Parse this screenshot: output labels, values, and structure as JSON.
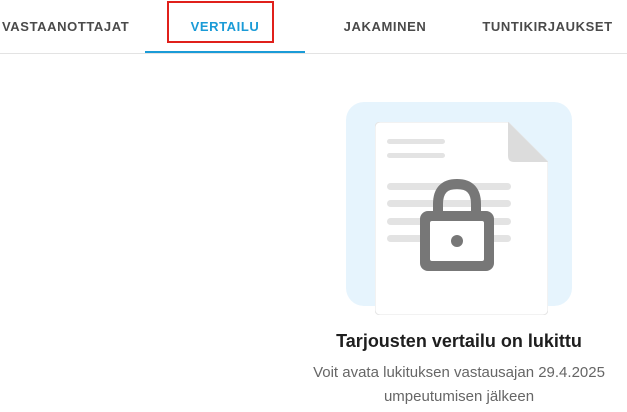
{
  "tabs": [
    {
      "label": "VASTAANOTTAJAT"
    },
    {
      "label": "VERTAILU"
    },
    {
      "label": "JAKAMINEN"
    },
    {
      "label": "TUNTIKIRJAUKSET"
    }
  ],
  "active_tab": "VERTAILU",
  "locked": {
    "title": "Tarjousten vertailu on lukittu",
    "subtitle_line1": "Voit avata lukituksen vastausajan 29.4.2025",
    "subtitle_line2": "umpeutumisen jälkeen"
  },
  "colors": {
    "accent": "#1a9bd7",
    "highlight": "#e0201b",
    "illustration_bg": "#e6f4fd",
    "lock": "#777777"
  },
  "icons": [
    "document-icon",
    "lock-icon"
  ]
}
